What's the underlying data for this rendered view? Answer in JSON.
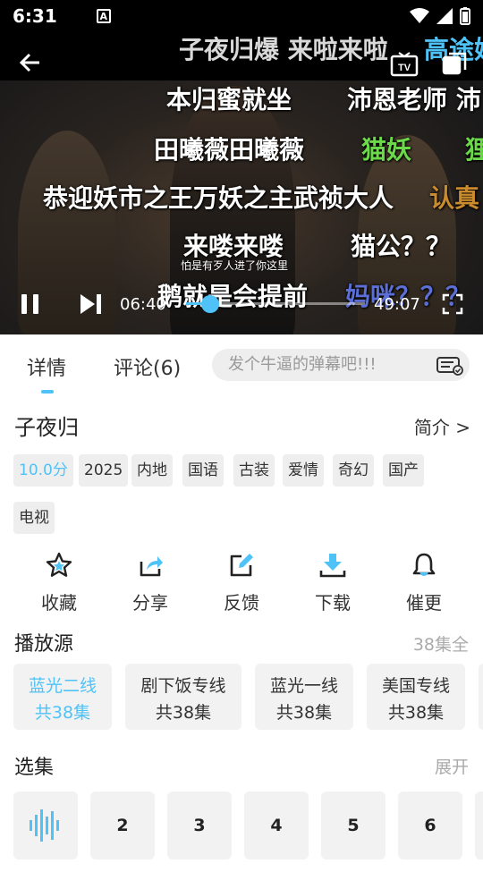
{
  "status": {
    "time": "6:31",
    "a_badge": "A"
  },
  "danmaku": [
    {
      "text": "子夜归爆  来啦来啦",
      "color": "#d9d9d9"
    },
    {
      "text": "高途妈",
      "color": "#4fc3f7"
    },
    {
      "text": "本归蜜就坐",
      "color": "#ffffff"
    },
    {
      "text": "沛恩老师 沛",
      "color": "#ffffff"
    },
    {
      "text": "田曦薇田曦薇",
      "color": "#ffffff"
    },
    {
      "text": "猫妖",
      "color": "#6cd94a"
    },
    {
      "text": "狸",
      "color": "#6cd94a"
    },
    {
      "text": "恭迎妖市之王万妖之主武祯大人",
      "color": "#ffffff"
    },
    {
      "text": "认真",
      "color": "#c98b2d"
    },
    {
      "text": "来喽来喽",
      "color": "#ffffff"
    },
    {
      "text": "猫公？？",
      "color": "#ffffff"
    },
    {
      "text": "鹅就是会提前",
      "color": "#ffffff"
    },
    {
      "text": "妈咪？？？",
      "color": "#5b6fd6"
    }
  ],
  "video": {
    "subtitle": "怕是有歹人进了你这里",
    "current_time": "06:40",
    "total_time": "49:07",
    "progress_fraction": 0.136
  },
  "tabs": [
    {
      "label": "详情"
    },
    {
      "label": "评论(6)"
    }
  ],
  "danmu_input": {
    "placeholder": "发个牛逼的弹幕吧!!!"
  },
  "show": {
    "title": "子夜归",
    "intro_label": "简介 >",
    "tags": [
      "10.0分",
      "2025",
      "内地",
      "国语",
      "古装",
      "爱情",
      "奇幻",
      "国产",
      "电视"
    ]
  },
  "actions": [
    {
      "label": "收藏",
      "icon": "star-icon"
    },
    {
      "label": "分享",
      "icon": "share-icon"
    },
    {
      "label": "反馈",
      "icon": "edit-icon"
    },
    {
      "label": "下载",
      "icon": "download-icon"
    },
    {
      "label": "催更",
      "icon": "bell-icon"
    }
  ],
  "sources": {
    "title": "播放源",
    "summary": "38集全",
    "items": [
      {
        "name": "蓝光二线",
        "count": "共38集"
      },
      {
        "name": "剧下饭专线",
        "count": "共38集"
      },
      {
        "name": "蓝光一线",
        "count": "共38集"
      },
      {
        "name": "美国专线",
        "count": "共38集"
      }
    ]
  },
  "episodes": {
    "title": "选集",
    "expand_label": "展开",
    "items": [
      "2",
      "3",
      "4",
      "5",
      "6"
    ]
  },
  "colors": {
    "accent": "#4fc3f7"
  }
}
